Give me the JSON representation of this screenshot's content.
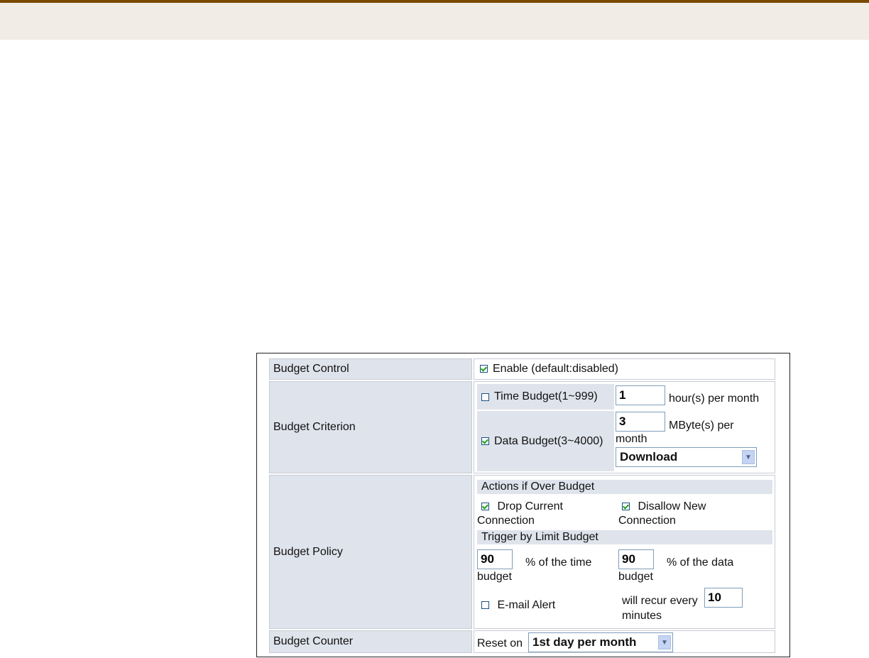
{
  "budget_control": {
    "label": "Budget Control",
    "enable_checked": true,
    "enable_label": "Enable (default:disabled)"
  },
  "budget_criterion": {
    "label": "Budget Criterion",
    "time_checked": false,
    "time_label": "Time Budget(1~999)",
    "time_value": "1",
    "time_unit": "hour(s) per month",
    "data_checked": true,
    "data_label": "Data Budget(3~4000)",
    "data_value": "3",
    "data_unit_line1": "MByte(s) per",
    "data_unit_line2": "month",
    "direction_selected": "Download"
  },
  "budget_policy": {
    "label": "Budget Policy",
    "actions_header": "Actions if Over Budget",
    "drop_checked": true,
    "drop_line1": "Drop Current",
    "drop_line2": "Connection",
    "disallow_checked": true,
    "disallow_line1": "Disallow New",
    "disallow_line2": "Connection",
    "trigger_header": "Trigger by Limit Budget",
    "time_pct": "90",
    "time_pct_line1": "% of the time",
    "time_pct_line2": "budget",
    "data_pct": "90",
    "data_pct_line1": "% of the data",
    "data_pct_line2": "budget",
    "email_checked": false,
    "email_label": "E-mail Alert",
    "recur_line1": "will recur every",
    "recur_value": "10",
    "recur_line2": "minutes"
  },
  "budget_counter": {
    "label": "Budget Counter",
    "reset_label": "Reset on",
    "reset_selected": "1st day per month"
  },
  "colors": {
    "header_border": "#7a4a00",
    "header_bg": "#f1ece5",
    "label_bg": "#dfe3ec",
    "check_green": "#21a121"
  }
}
